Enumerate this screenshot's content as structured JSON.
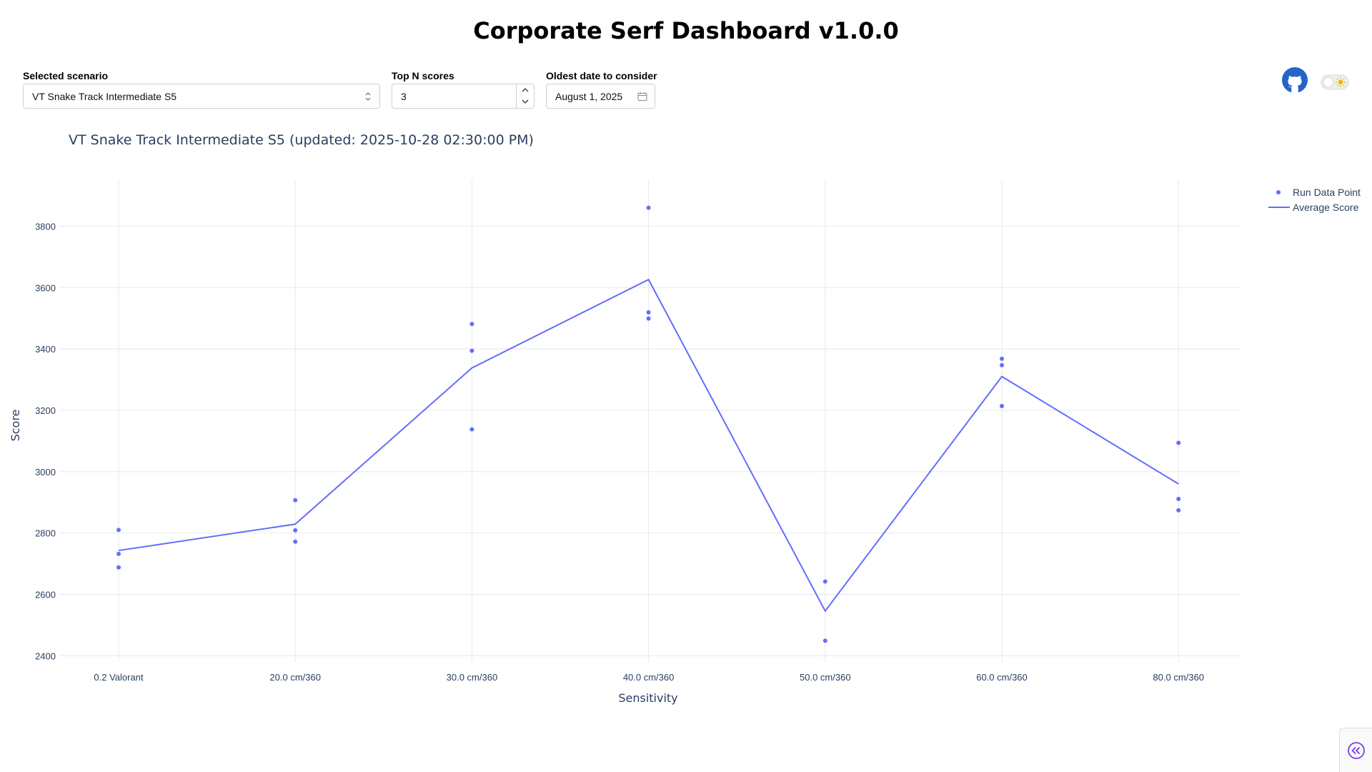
{
  "app": {
    "title": "Corporate Serf Dashboard v1.0.0"
  },
  "controls": {
    "scenario_label": "Selected scenario",
    "scenario_value": "VT Snake Track Intermediate S5",
    "topn_label": "Top N scores",
    "topn_value": "3",
    "date_label": "Oldest date to consider",
    "date_value": "August 1, 2025"
  },
  "icons": {
    "github": "github-icon",
    "theme": "theme-toggle-icon",
    "sidebar": "chevrons-left-icon",
    "calendar": "calendar-icon",
    "select": "chevron-up-down-icon"
  },
  "colors": {
    "accent": "#636efa",
    "grid": "#e5e8ef",
    "text": "#2a3f5f",
    "github": "#2563c9",
    "sidebar_icon": "#7c3aed"
  },
  "chart_data": {
    "type": "line",
    "title": "VT Snake Track Intermediate S5 (updated: 2025-10-28 02:30:00 PM)",
    "xlabel": "Sensitivity",
    "ylabel": "Score",
    "categories": [
      "0.2 Valorant",
      "20.0 cm/360",
      "30.0 cm/360",
      "40.0 cm/360",
      "50.0 cm/360",
      "60.0 cm/360",
      "80.0 cm/360"
    ],
    "ylim": [
      2380,
      3950
    ],
    "yticks": [
      2400,
      2600,
      2800,
      3000,
      3200,
      3400,
      3600,
      3800
    ],
    "grid": true,
    "legend_position": "top-right",
    "series": [
      {
        "name": "Run Data Point",
        "mode": "markers",
        "points": [
          {
            "x": "0.2 Valorant",
            "y": 2810
          },
          {
            "x": "0.2 Valorant",
            "y": 2732
          },
          {
            "x": "0.2 Valorant",
            "y": 2688
          },
          {
            "x": "20.0 cm/360",
            "y": 2907
          },
          {
            "x": "20.0 cm/360",
            "y": 2809
          },
          {
            "x": "20.0 cm/360",
            "y": 2772
          },
          {
            "x": "30.0 cm/360",
            "y": 3481
          },
          {
            "x": "30.0 cm/360",
            "y": 3394
          },
          {
            "x": "30.0 cm/360",
            "y": 3138
          },
          {
            "x": "40.0 cm/360",
            "y": 3860
          },
          {
            "x": "40.0 cm/360",
            "y": 3519
          },
          {
            "x": "40.0 cm/360",
            "y": 3499
          },
          {
            "x": "50.0 cm/360",
            "y": 2642
          },
          {
            "x": "50.0 cm/360",
            "y": 2449
          },
          {
            "x": "60.0 cm/360",
            "y": 3368
          },
          {
            "x": "60.0 cm/360",
            "y": 3347
          },
          {
            "x": "60.0 cm/360",
            "y": 3214
          },
          {
            "x": "80.0 cm/360",
            "y": 3094
          },
          {
            "x": "80.0 cm/360",
            "y": 2911
          },
          {
            "x": "80.0 cm/360",
            "y": 2874
          }
        ]
      },
      {
        "name": "Average Score",
        "mode": "lines",
        "values": [
          2743,
          2829,
          3338,
          3626,
          2546,
          3310,
          2960
        ]
      }
    ]
  }
}
